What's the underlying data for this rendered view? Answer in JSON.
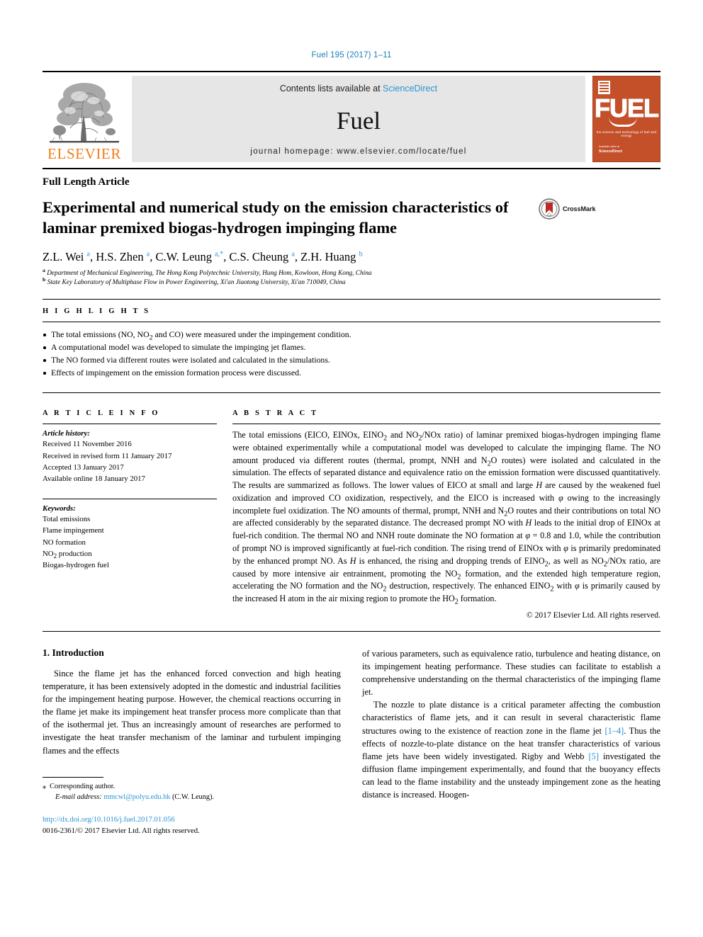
{
  "running_head": "Fuel 195 (2017) 1–11",
  "masthead": {
    "publisher_name": "ELSEVIER",
    "contents_prefix": "Contents lists available at",
    "contents_link": "ScienceDirect",
    "journal_name": "Fuel",
    "homepage": "journal homepage: www.elsevier.com/locate/fuel",
    "cover_title": "FUEL",
    "cover_subtitle": "the science and technology of fuel and energy",
    "cover_footer_small": "Available online at",
    "cover_footer_brand": "ScienceDirect"
  },
  "article": {
    "type": "Full Length Article",
    "title": "Experimental and numerical study on the emission characteristics of laminar premixed biogas-hydrogen impinging flame",
    "crossmark_label": "CrossMark",
    "authors": "Z.L. Wei a, H.S. Zhen a, C.W. Leung a,*, C.S. Cheung a, Z.H. Huang b",
    "affiliations": [
      "a Department of Mechanical Engineering, The Hong Kong Polytechnic University, Hung Hom, Kowloon, Hong Kong, China",
      "b State Key Laboratory of Multiphase Flow in Power Engineering, Xi'an Jiaotong University, Xi'an 710049, China"
    ]
  },
  "highlights": {
    "heading": "H I G H L I G H T S",
    "items": [
      "The total emissions (NO, NO2 and CO) were measured under the impingement condition.",
      "A computational model was developed to simulate the impinging jet flames.",
      "The NO formed via different routes were isolated and calculated in the simulations.",
      "Effects of impingement on the emission formation process were discussed."
    ]
  },
  "article_info": {
    "heading": "A R T I C L E   I N F O",
    "history_label": "Article history:",
    "history": [
      "Received 11 November 2016",
      "Received in revised form 11 January 2017",
      "Accepted 13 January 2017",
      "Available online 18 January 2017"
    ],
    "keywords_label": "Keywords:",
    "keywords": [
      "Total emissions",
      "Flame impingement",
      "NO formation",
      "NO2 production",
      "Biogas-hydrogen fuel"
    ]
  },
  "abstract": {
    "heading": "A B S T R A C T",
    "text": "The total emissions (EICO, EINOx, EINO2 and NO2/NOx ratio) of laminar premixed biogas-hydrogen impinging flame were obtained experimentally while a computational model was developed to calculate the impinging flame. The NO amount produced via different routes (thermal, prompt, NNH and N2O routes) were isolated and calculated in the simulation. The effects of separated distance and equivalence ratio on the emission formation were discussed quantitatively. The results are summarized as follows. The lower values of EICO at small and large H are caused by the weakened fuel oxidization and improved CO oxidization, respectively, and the EICO is increased with φ owing to the increasingly incomplete fuel oxidization. The NO amounts of thermal, prompt, NNH and N2O routes and their contributions on total NO are affected considerably by the separated distance. The decreased prompt NO with H leads to the initial drop of EINOx at fuel-rich condition. The thermal NO and NNH route dominate the NO formation at φ = 0.8 and 1.0, while the contribution of prompt NO is improved significantly at fuel-rich condition. The rising trend of EINOx with φ is primarily predominated by the enhanced prompt NO. As H is enhanced, the rising and dropping trends of EINO2, as well as NO2/NOx ratio, are caused by more intensive air entrainment, promoting the NO2 formation, and the extended high temperature region, accelerating the NO formation and the NO2 destruction, respectively. The enhanced EINO2 with φ is primarily caused by the increased H atom in the air mixing region to promote the HO2 formation.",
    "copyright": "© 2017 Elsevier Ltd. All rights reserved."
  },
  "introduction": {
    "section_title": "1. Introduction",
    "left_paragraph": "Since the flame jet has the enhanced forced convection and high heating temperature, it has been extensively adopted in the domestic and industrial facilities for the impingement heating purpose. However, the chemical reactions occurring in the flame jet make its impingement heat transfer process more complicate than that of the isothermal jet. Thus an increasingly amount of researches are performed to investigate the heat transfer mechanism of the laminar and turbulent impinging flames and the effects",
    "right_paragraph_1": "of various parameters, such as equivalence ratio, turbulence and heating distance, on its impingement heating performance. These studies can facilitate to establish a comprehensive understanding on the thermal characteristics of the impinging flame jet.",
    "right_paragraph_2_a": "The nozzle to plate distance is a critical parameter affecting the combustion characteristics of flame jets, and it can result in several characteristic flame structures owing to the existence of reaction zone in the flame jet ",
    "right_citation_1": "[1–4]",
    "right_paragraph_2_b": ". Thus the effects of nozzle-to-plate distance on the heat transfer characteristics of various flame jets have been widely investigated. Rigby and Webb ",
    "right_citation_2": "[5]",
    "right_paragraph_2_c": " investigated the diffusion flame impingement experimentally, and found that the buoyancy effects can lead to the flame instability and the unsteady impingement zone as the heating distance is increased. Hoogen-"
  },
  "footer": {
    "corresponding_marker": "⁎",
    "corresponding_label": "Corresponding author.",
    "email_label": "E-mail address:",
    "email": "mmcwl@polyu.edu.hk",
    "email_owner": "(C.W. Leung).",
    "doi": "http://dx.doi.org/10.1016/j.fuel.2017.01.056",
    "issn": "0016-2361/© 2017 Elsevier Ltd. All rights reserved."
  },
  "colors": {
    "link_blue": "#2a93d5",
    "elsevier_orange": "#f07d18",
    "cover_red": "#c4502a",
    "masthead_gray": "#e6e6e6"
  }
}
